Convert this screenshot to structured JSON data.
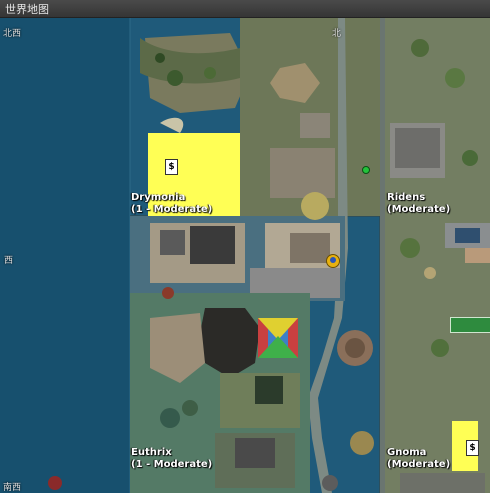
{
  "window": {
    "title": "世界地图"
  },
  "compass": {
    "northwest": "北西",
    "north": "北",
    "west": "西",
    "southwest": "南西"
  },
  "regions": [
    {
      "name": "Drymonia",
      "rating": "(1 - Moderate)"
    },
    {
      "name": "Ridens",
      "rating": "(Moderate)"
    },
    {
      "name": "Euthrix",
      "rating": "(1 - Moderate)"
    },
    {
      "name": "Gnoma",
      "rating": "(Moderate)"
    }
  ],
  "markers": {
    "land_for_sale": "$"
  },
  "colors": {
    "water": "#1f5a7a",
    "land": "#6f7a5c",
    "for_sale": "#ffff55",
    "road": "#7d8a84"
  }
}
